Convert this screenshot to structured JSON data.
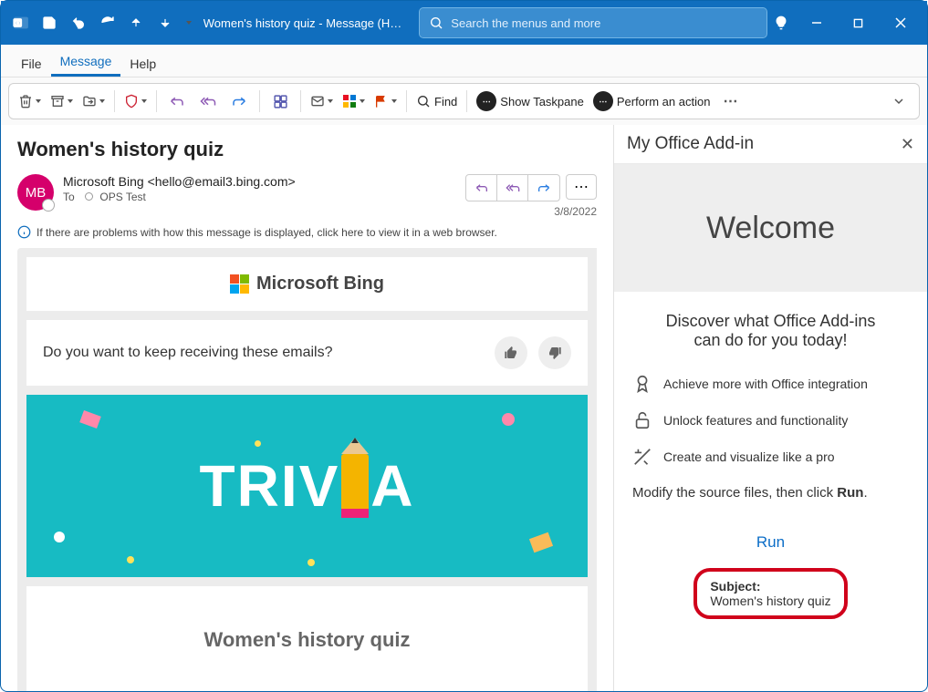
{
  "titlebar": {
    "title_text": "Women's history quiz  -  Message (HT...",
    "search_placeholder": "Search the menus and more"
  },
  "tabs": {
    "file": "File",
    "message": "Message",
    "help": "Help"
  },
  "ribbon": {
    "find": "Find",
    "show_taskpane": "Show Taskpane",
    "perform_action": "Perform an action"
  },
  "mail": {
    "subject": "Women's history quiz",
    "avatar_initials": "MB",
    "from": "Microsoft Bing  <hello@email3.bing.com>",
    "to_label": "To",
    "to_name": "OPS Test",
    "date": "3/8/2022",
    "info_text": "If there are problems with how this message is displayed, click here to view it in a web browser.",
    "bing_brand": "Microsoft Bing",
    "keep_receiving": "Do you want to keep receiving these emails?",
    "trivia_pre": "TRIV",
    "trivia_post": "A",
    "quiz_title": "Women's history quiz"
  },
  "addin": {
    "pane_title": "My Office Add-in",
    "welcome": "Welcome",
    "head_line_1": "Discover what Office Add-ins",
    "head_line_2": "can do for you today!",
    "feature_1": "Achieve more with Office integration",
    "feature_2": "Unlock features and functionality",
    "feature_3": "Create and visualize like a pro",
    "instruction_pre": "Modify the source files, then click ",
    "instruction_bold": "Run",
    "instruction_post": ".",
    "run_link": "Run",
    "result_label": "Subject:",
    "result_value": "Women's history quiz"
  }
}
